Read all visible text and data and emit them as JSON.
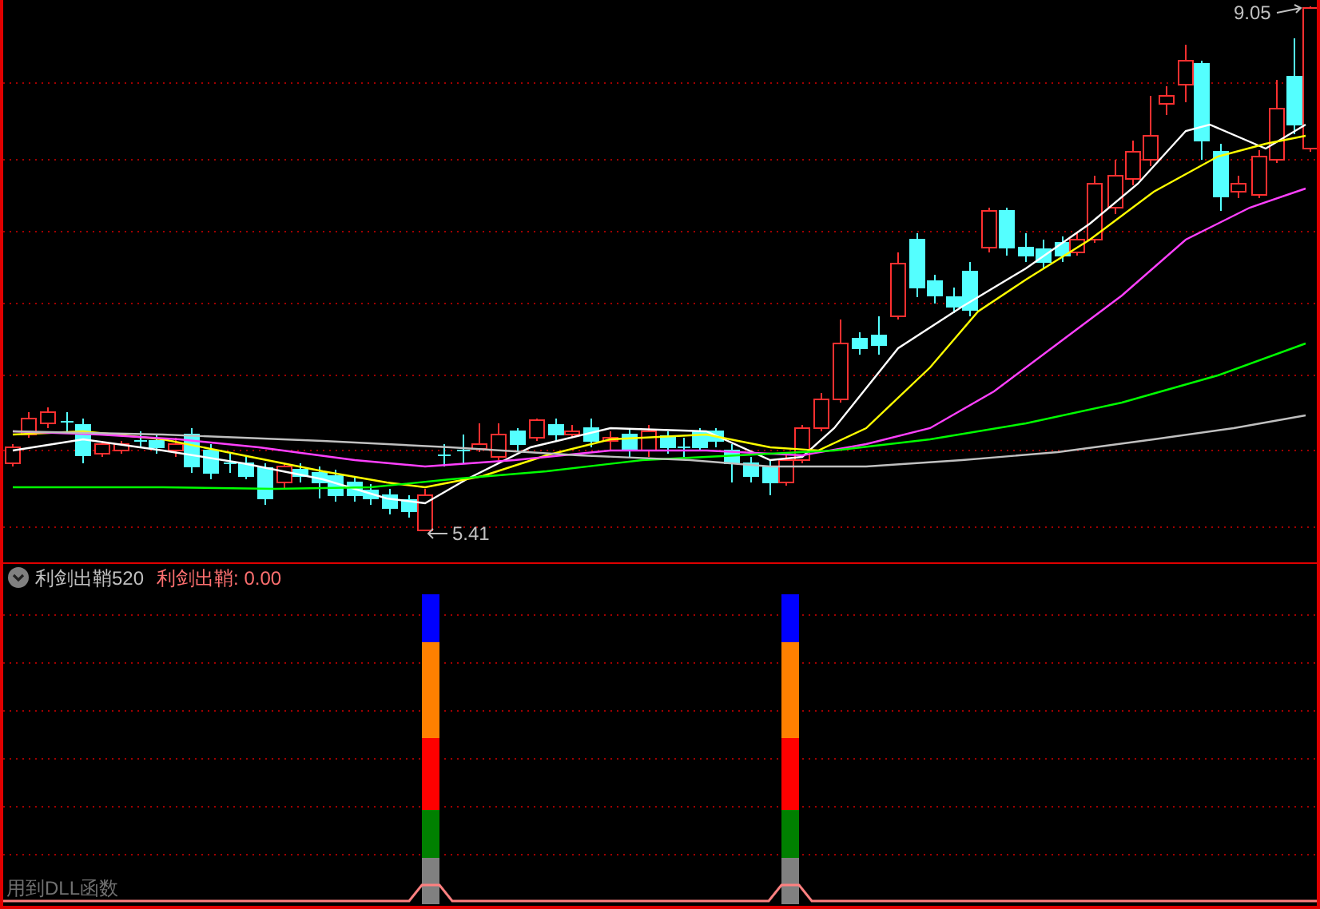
{
  "price_panel": {
    "high_label": "9.05",
    "low_label": "5.41"
  },
  "indicator_panel": {
    "name": "利剑出鞘520",
    "line_label": "利剑出鞘: 0.00",
    "footer_text": "用到DLL函数"
  }
}
